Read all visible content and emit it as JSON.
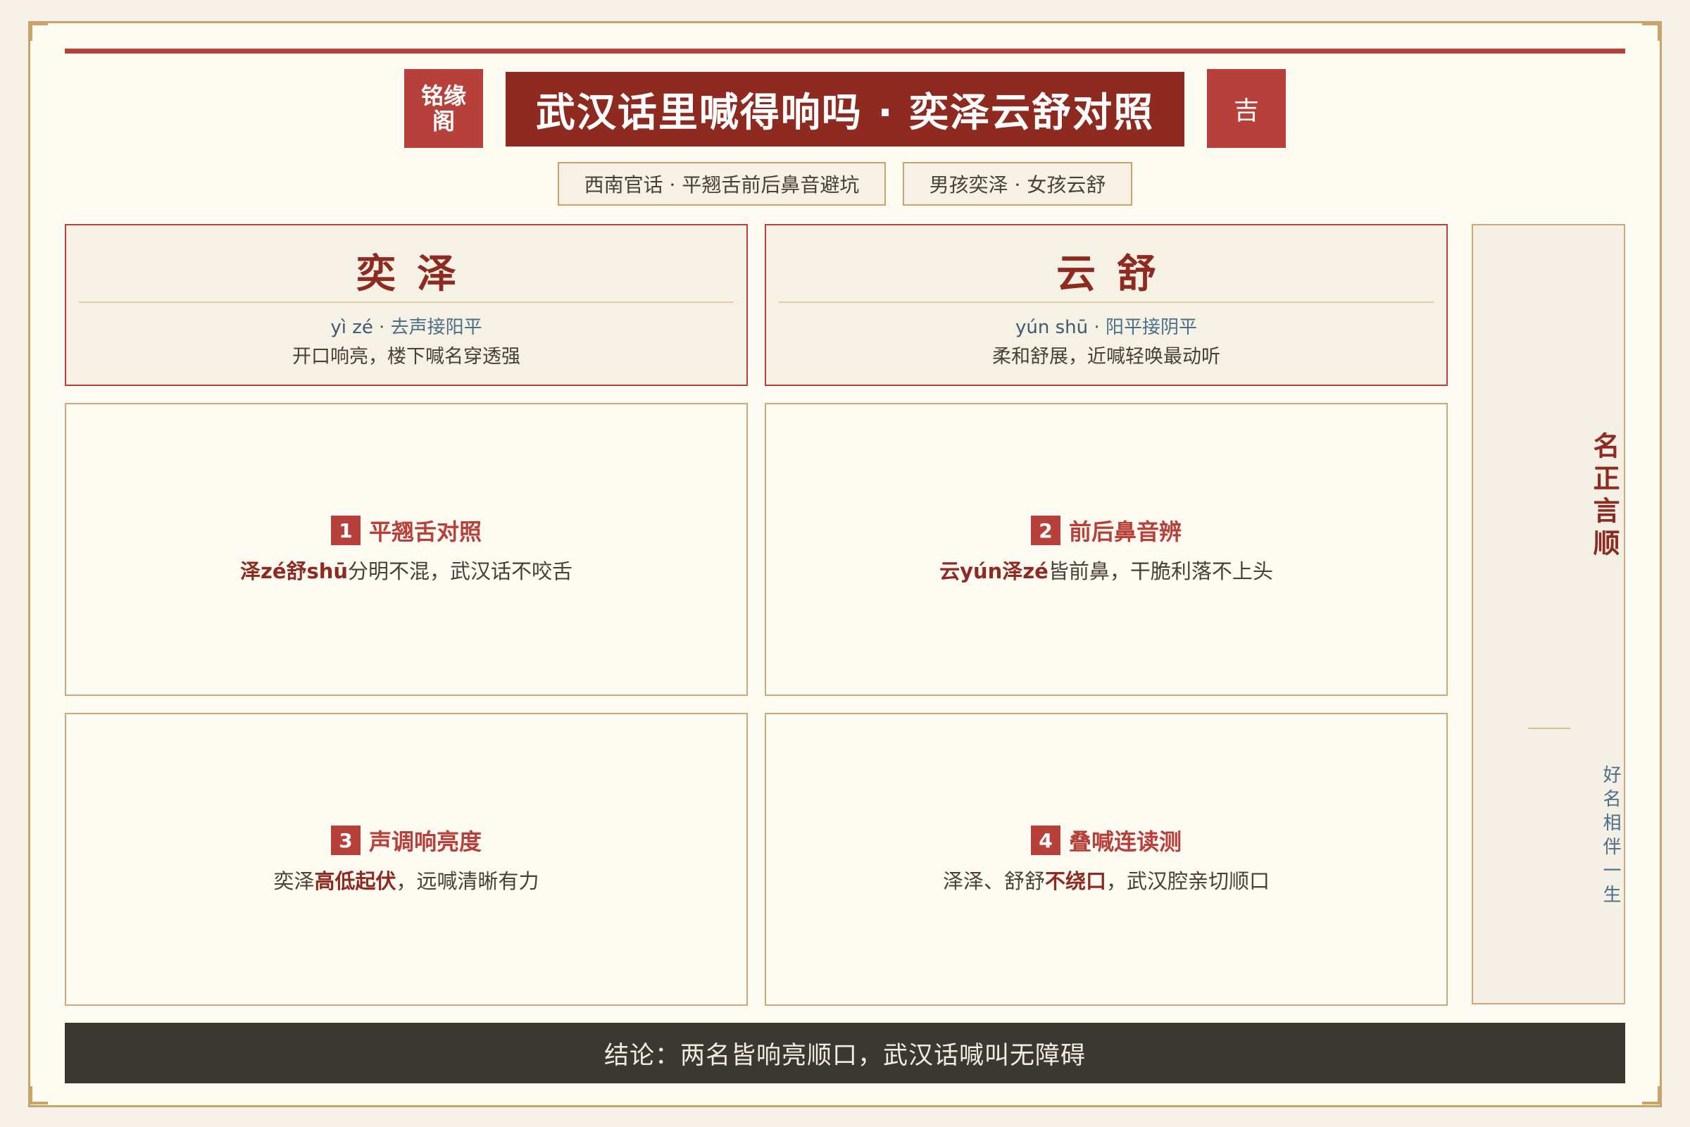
{
  "header": {
    "brand_badge": "铭缘阁",
    "brand_line1": "铭缘",
    "brand_line2": "阁",
    "title": "武汉话里喊得响吗 · 奕泽云舒对照",
    "luck_badge": "吉"
  },
  "tags": [
    "西南官话 · 平翘舌前后鼻音避坑",
    "男孩奕泽 · 女孩云舒"
  ],
  "names": [
    {
      "name": "奕泽",
      "pinyin": "yì zé",
      "sep": " · ",
      "tone": "去声接阳平",
      "desc": "开口响亮，楼下喊名穿透强"
    },
    {
      "name": "云舒",
      "pinyin": "yún shū",
      "sep": " · ",
      "tone": "阳平接阴平",
      "desc": "柔和舒展，近喊轻唤最动听"
    }
  ],
  "cards": [
    {
      "num": "1",
      "title": "平翘舌对照",
      "hl": "泽zé舒shū",
      "rest": "分明不混，武汉话不咬舌"
    },
    {
      "num": "2",
      "title": "前后鼻音辨",
      "hl": "云yún泽zé",
      "rest": "皆前鼻，干脆利落不上头"
    },
    {
      "num": "3",
      "title": "声调响亮度",
      "pre": "奕泽",
      "hl": "高低起伏",
      "rest": "，远喊清晰有力"
    },
    {
      "num": "4",
      "title": "叠喊连读测",
      "pre": "泽泽、舒舒",
      "hl": "不绕口",
      "rest": "，武汉腔亲切顺口"
    }
  ],
  "side": {
    "motto": "名正言顺",
    "sub": "好名相伴一生"
  },
  "conclusion": "结论：两名皆响亮顺口，武汉话喊叫无障碍",
  "colors": {
    "primary": "#b8403a",
    "dark_red": "#8e2a20",
    "gold": "#c9a46a",
    "ink": "#3b3731"
  }
}
